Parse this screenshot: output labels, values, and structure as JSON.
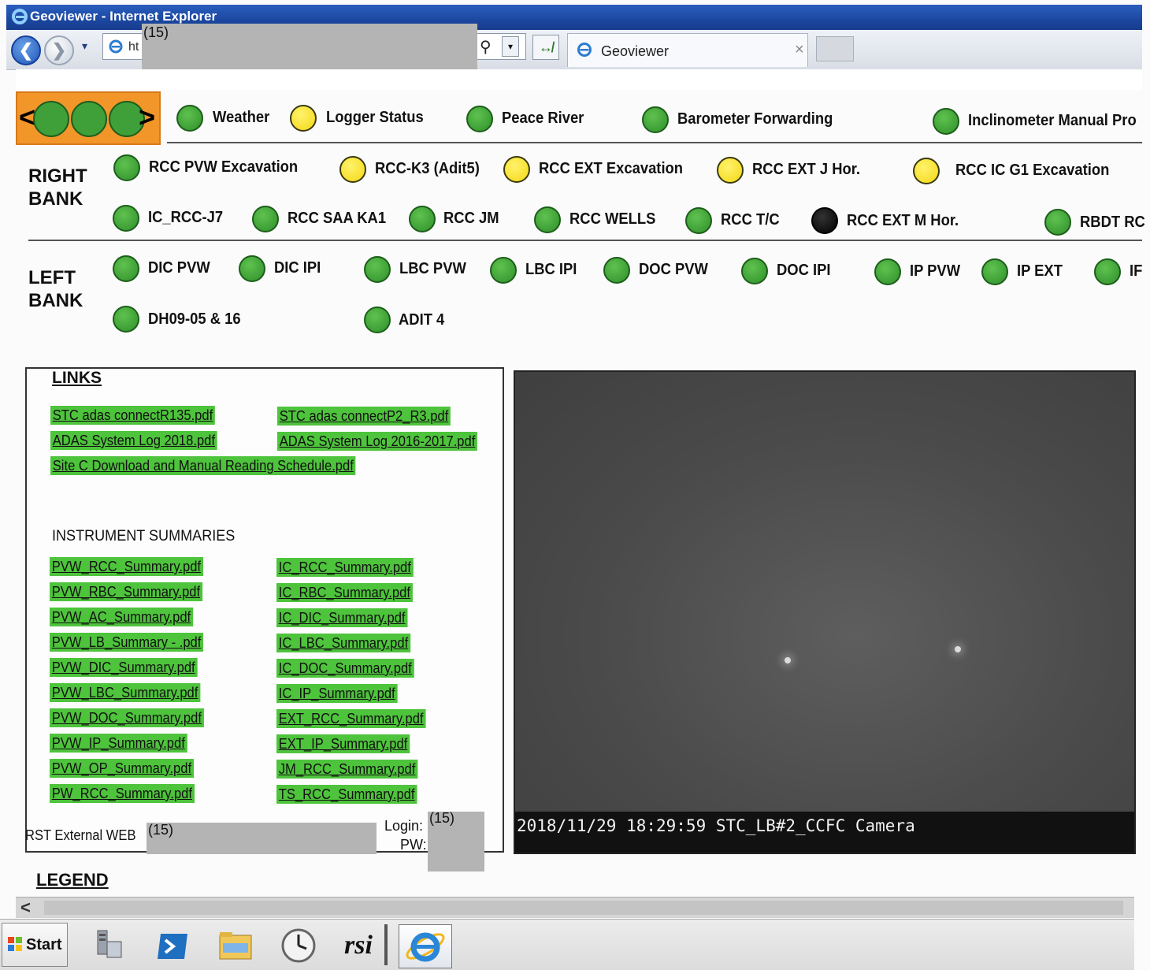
{
  "window": {
    "title": "Geoviewer - Internet Explorer"
  },
  "address_bar": {
    "url_fragment": "ht",
    "redaction_tag": "(15)",
    "tab_title": "Geoviewer",
    "tab_close": "×",
    "back_glyph": "❮",
    "forward_glyph": "❯",
    "dropdown_glyph": "▾",
    "refresh_glyph": "↮",
    "search_glyph": "⚲"
  },
  "logo": {
    "left_glyph": "<",
    "right_glyph": ">"
  },
  "status_colors": {
    "green": "#3fa03a",
    "yellow": "#f4d816",
    "black": "#000000"
  },
  "top_items": [
    {
      "label": "Weather",
      "status": "green"
    },
    {
      "label": "Logger Status",
      "status": "yellow"
    },
    {
      "label": "Peace River",
      "status": "green"
    },
    {
      "label": "Barometer Forwarding",
      "status": "green"
    },
    {
      "label": "Inclinometer Manual Pro",
      "status": "green"
    }
  ],
  "right_bank": {
    "label_line1": "RIGHT",
    "label_line2": "BANK",
    "row1": [
      {
        "label": "RCC PVW Excavation",
        "status": "green"
      },
      {
        "label": "RCC-K3 (Adit5)",
        "status": "yellow"
      },
      {
        "label": "RCC EXT Excavation",
        "status": "yellow"
      },
      {
        "label": "RCC EXT J Hor.",
        "status": "yellow"
      },
      {
        "label": "RCC IC G1 Excavation",
        "status": "yellow"
      }
    ],
    "row2": [
      {
        "label": "IC_RCC-J7",
        "status": "green"
      },
      {
        "label": "RCC SAA KA1",
        "status": "green"
      },
      {
        "label": "RCC JM",
        "status": "green"
      },
      {
        "label": "RCC WELLS",
        "status": "green"
      },
      {
        "label": "RCC T/C",
        "status": "green"
      },
      {
        "label": "RCC EXT M Hor.",
        "status": "black"
      },
      {
        "label": "RBDT RC",
        "status": "green"
      }
    ]
  },
  "left_bank": {
    "label_line1": "LEFT",
    "label_line2": "BANK",
    "row1": [
      {
        "label": "DIC PVW",
        "status": "green"
      },
      {
        "label": "DIC IPI",
        "status": "green"
      },
      {
        "label": "LBC PVW",
        "status": "green"
      },
      {
        "label": "LBC IPI",
        "status": "green"
      },
      {
        "label": "DOC PVW",
        "status": "green"
      },
      {
        "label": "DOC IPI",
        "status": "green"
      },
      {
        "label": "IP PVW",
        "status": "green"
      },
      {
        "label": "IP EXT",
        "status": "green"
      },
      {
        "label": "IF",
        "status": "green"
      }
    ],
    "row2": [
      {
        "label": "DH09-05 & 16",
        "status": "green"
      },
      {
        "label": "ADIT 4",
        "status": "green"
      }
    ]
  },
  "links_panel": {
    "title": "LINKS",
    "links": [
      "STC adas connectR135.pdf",
      "STC adas connectP2_R3.pdf",
      "ADAS System Log 2018.pdf",
      "ADAS System Log 2016-2017.pdf",
      "Site C Download and Manual Reading Schedule.pdf"
    ],
    "summaries_title": "INSTRUMENT SUMMARIES",
    "summaries_left": [
      "PVW_RCC_Summary.pdf",
      "PVW_RBC_Summary.pdf",
      "PVW_AC_Summary.pdf",
      "PVW_LB_Summary - .pdf",
      "PVW_DIC_Summary.pdf",
      "PVW_LBC_Summary.pdf",
      "PVW_DOC_Summary.pdf",
      "PVW_IP_Summary.pdf",
      "PVW_OP_Summary.pdf",
      "PW_RCC_Summary.pdf"
    ],
    "summaries_right": [
      "IC_RCC_Summary.pdf",
      "IC_RBC_Summary.pdf",
      "IC_DIC_Summary.pdf",
      "IC_LBC_Summary.pdf",
      "IC_DOC_Summary.pdf",
      "IC_IP_Summary.pdf",
      "EXT_RCC_Summary.pdf",
      "EXT_IP_Summary.pdf",
      "JM_RCC_Summary.pdf",
      "TS_RCC_Summary.pdf"
    ],
    "rst_label": "RST External WEB",
    "rst_redaction_tag": "(15)",
    "login_label": "Login:",
    "pw_label": "PW:",
    "login_redaction_tag": "(15)"
  },
  "camera": {
    "overlay": "2018/11/29 18:29:59 STC_LB#2_CCFC Camera"
  },
  "legend": {
    "title": "LEGEND"
  },
  "scrollbar": {
    "left_arrow": "<"
  },
  "taskbar": {
    "start_label": "Start",
    "rsi_label": "rsi"
  }
}
